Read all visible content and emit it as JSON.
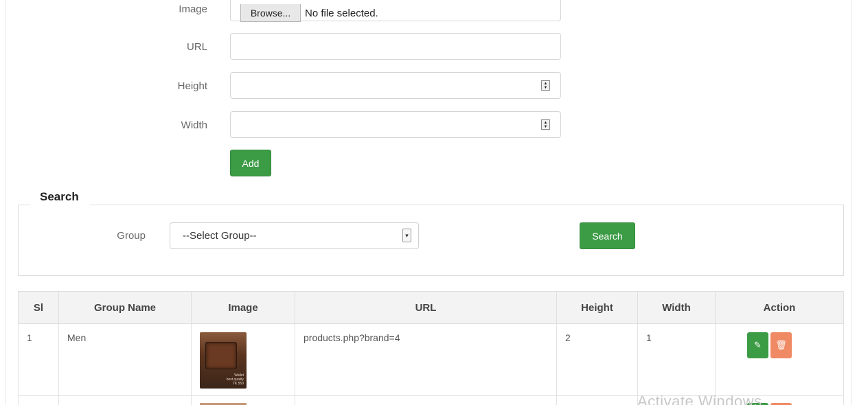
{
  "form": {
    "image_label": "Image",
    "browse_label": "Browse...",
    "file_status": "No file selected.",
    "url_label": "URL",
    "url_value": "",
    "height_label": "Height",
    "height_value": "",
    "width_label": "Width",
    "width_value": "",
    "add_label": "Add"
  },
  "search": {
    "title": "Search",
    "group_label": "Group",
    "group_selected": "--Select Group--",
    "search_label": "Search"
  },
  "table": {
    "headers": [
      "Sl",
      "Group Name",
      "Image",
      "URL",
      "Height",
      "Width",
      "Action"
    ],
    "rows": [
      {
        "sl": "1",
        "group_name": "Men",
        "url": "products.php?brand=4",
        "height": "2",
        "width": "1"
      }
    ]
  },
  "thumbnail_text": "Wallet\nbest quality\nTK 550",
  "watermark": "Activate Windows",
  "colors": {
    "accent_green": "#3c9b45",
    "delete_orange": "#f08a64"
  }
}
